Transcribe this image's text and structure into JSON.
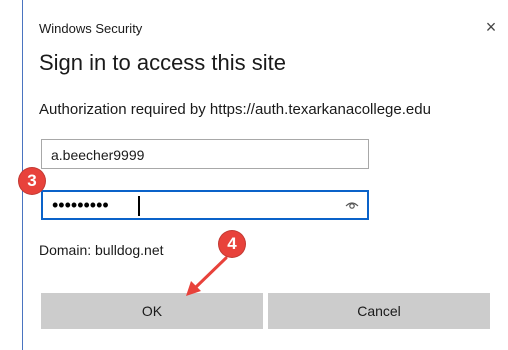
{
  "window": {
    "title": "Windows Security",
    "close_glyph": "×"
  },
  "heading": "Sign in to access this site",
  "auth_message": "Authorization required by https://auth.texarkanacollege.edu",
  "username": {
    "value": "a.beecher9999"
  },
  "password": {
    "masked_value": "•••••••••",
    "reveal_icon": "eye-icon"
  },
  "domain_text": "Domain: bulldog.net",
  "buttons": {
    "ok": "OK",
    "cancel": "Cancel"
  },
  "annotations": {
    "step_password": "3",
    "step_ok": "4",
    "color": "#e8423b"
  }
}
